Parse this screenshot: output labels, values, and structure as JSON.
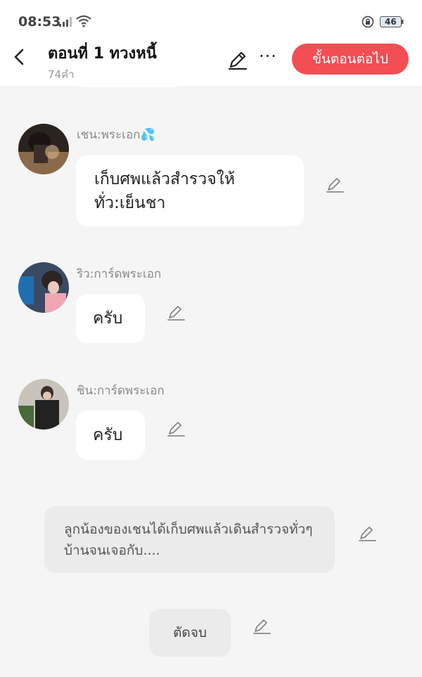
{
  "status_bar": {
    "time": "08:53",
    "battery": "46",
    "icons": [
      "signal-icon",
      "wifi-icon",
      "rotation-lock-icon",
      "battery-icon"
    ]
  },
  "header": {
    "title": "ตอนที่ 1 ทวงหนี้",
    "word_count": "74คำ",
    "next_button": "ขั้นตอนต่อไป",
    "more_label": "···",
    "accent_color": "#f24e54"
  },
  "messages": [
    {
      "speaker": "เชน:พระเอก💦",
      "text": "เก็บศพแล้วสำรวจให้ทั่ว:เย็นชา"
    },
    {
      "speaker": "ริว:การ์ดพระเอก",
      "text": "ครับ"
    },
    {
      "speaker": "ชิน:การ์ดพระเอก",
      "text": "ครับ"
    }
  ],
  "narration": "ลูกน้องของเชนได้เก็บศพแล้วเดินสำรวจทั่วๆบ้านจนเจอกับ....",
  "cut_label": "ตัดจบ"
}
